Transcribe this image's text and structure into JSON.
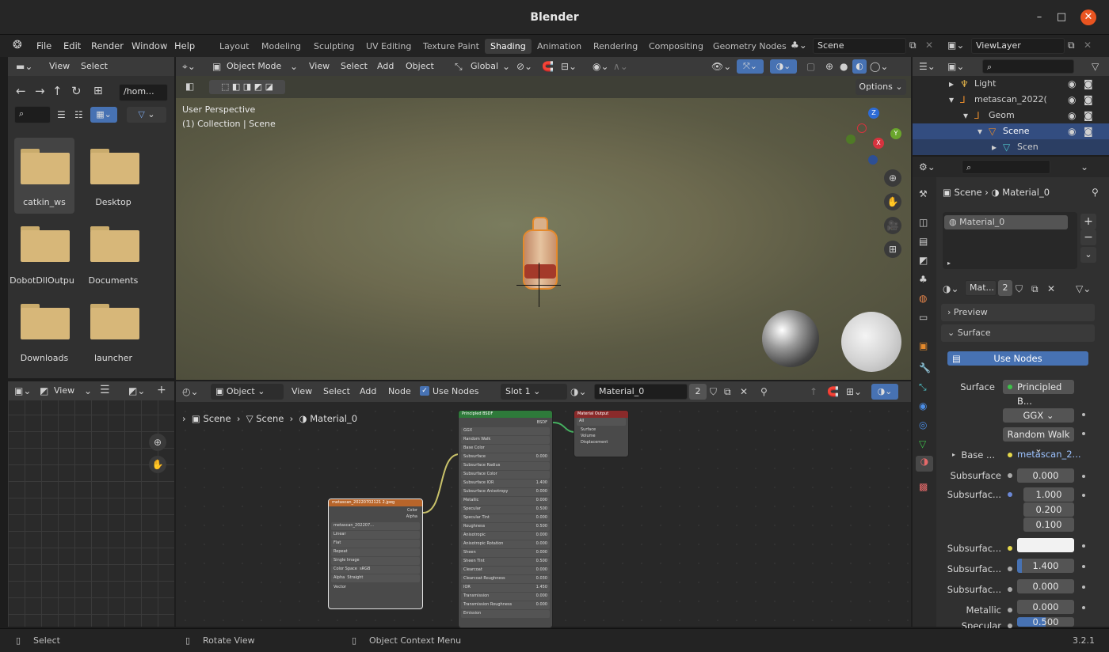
{
  "window": {
    "title": "Blender",
    "minimize": "–",
    "maximize": "□",
    "close": "✕"
  },
  "menu": [
    "File",
    "Edit",
    "Render",
    "Window",
    "Help"
  ],
  "workspaces": [
    "Layout",
    "Modeling",
    "Sculpting",
    "UV Editing",
    "Texture Paint",
    "Shading",
    "Animation",
    "Rendering",
    "Compositing",
    "Geometry Nodes"
  ],
  "active_workspace": "Shading",
  "scene_field": "Scene",
  "viewlayer_field": "ViewLayer",
  "file_browser": {
    "header": [
      "View",
      "Select"
    ],
    "path": "/hom...",
    "folders": [
      "catkin_ws",
      "Desktop",
      "DobotDllOutpu",
      "Documents",
      "Downloads",
      "launcher"
    ]
  },
  "image_editor": {
    "view": "View"
  },
  "viewport": {
    "mode": "Object Mode",
    "menus": [
      "View",
      "Select",
      "Add",
      "Object"
    ],
    "orientation": "Global",
    "options": "Options",
    "overlay_line1": "User Perspective",
    "overlay_line2": "(1) Collection | Scene",
    "axis_z": "Z",
    "axis_y": "Y",
    "axis_x": "X"
  },
  "outliner": {
    "items": [
      {
        "label": "Light"
      },
      {
        "label": "metascan_2022("
      },
      {
        "label": "Geom"
      },
      {
        "label": "Scene"
      },
      {
        "label": "Scen"
      }
    ]
  },
  "node_editor": {
    "type": "Object",
    "menus": [
      "View",
      "Select",
      "Add",
      "Node"
    ],
    "use_nodes": "Use Nodes",
    "slot": "Slot 1",
    "material": "Material_0",
    "users": "2",
    "breadcrumb": [
      "Scene",
      "Scene",
      "Material_0"
    ],
    "bsdf_title": "Principled BSDF",
    "bsdf_out": "BSDF",
    "bsdf_rows": [
      "GGX",
      "Random Walk",
      "Base Color",
      "Subsurface",
      "Subsurface Radius",
      "Subsurface Color",
      "Subsurface IOR",
      "Subsurface Anisotropy",
      "Metallic",
      "Specular",
      "Specular Tint",
      "Roughness",
      "Anisotropic",
      "Anisotropic Rotation",
      "Sheen",
      "Sheen Tint",
      "Clearcoat",
      "Clearcoat Roughness",
      "IOR",
      "Transmission",
      "Transmission Roughness",
      "Emission"
    ],
    "bsdf_vals": [
      "",
      "",
      "",
      "0.000",
      "",
      "",
      "1.400",
      "0.000",
      "0.000",
      "0.500",
      "0.000",
      "0.500",
      "0.000",
      "0.000",
      "0.000",
      "0.500",
      "0.000",
      "0.030",
      "1.450",
      "0.000",
      "0.000",
      ""
    ],
    "output_title": "Material Output",
    "output_rows": [
      "All",
      "Surface",
      "Volume",
      "Displacement"
    ],
    "image_title": "metascan_20220702121 2.jpeg",
    "image_out": [
      "Color",
      "Alpha"
    ],
    "image_name": "metascan_202207...",
    "image_rows": [
      "Linear",
      "Flat",
      "Repeat",
      "Single Image"
    ],
    "color_space_label": "Color Space",
    "color_space": "sRGB",
    "alpha_label": "Alpha",
    "alpha": "Straight",
    "vector": "Vector"
  },
  "properties": {
    "breadcrumb_scene": "Scene",
    "breadcrumb_material": "Material_0",
    "slot_item": "Material_0",
    "mat_short": "Mat...",
    "mat_users": "2",
    "preview": "Preview",
    "surface": "Surface",
    "use_nodes": "Use Nodes",
    "surface_label": "Surface",
    "surface_value": "Principled B...",
    "distribution": "GGX",
    "subsurface_method": "Random Walk",
    "base_label": "Base ...",
    "base_value": "metascan_2...",
    "rows": [
      {
        "label": "Subsurface",
        "value": "0.000"
      },
      {
        "label": "Subsurfac...",
        "value": "1.000"
      },
      {
        "label": "",
        "value": "0.200"
      },
      {
        "label": "",
        "value": "0.100"
      },
      {
        "label": "Subsurfac...",
        "value": ""
      },
      {
        "label": "Subsurfac...",
        "value": "1.400"
      },
      {
        "label": "Subsurfac...",
        "value": "0.000"
      },
      {
        "label": "Metallic",
        "value": "0.000"
      },
      {
        "label": "Specular",
        "value": "0.500"
      }
    ]
  },
  "status": {
    "select": "Select",
    "rotate": "Rotate View",
    "context": "Object Context Menu",
    "version": "3.2.1"
  },
  "colors": {
    "accent": "#4772b3",
    "selected_orange": "#e58a2c",
    "close": "#e95420",
    "node_green": "#2e7a3a",
    "node_red": "#8a2a2a",
    "node_orange": "#b8652a"
  }
}
